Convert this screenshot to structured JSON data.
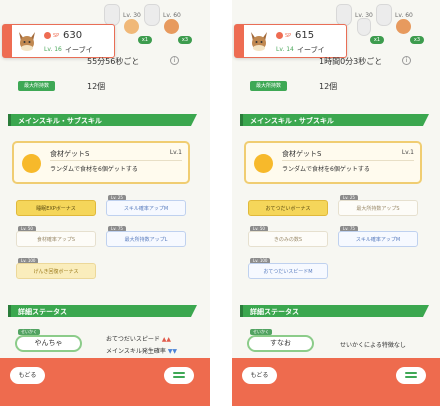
{
  "colors": {
    "accent_green": "#3ba74f",
    "accent_red": "#ee6c52",
    "skill_gold": "#f5d65a",
    "skill_blue": "#5a7dbf"
  },
  "left": {
    "top_items": [
      {
        "level": "Lv. 30",
        "count": "x1"
      },
      {
        "level": "Lv. 60",
        "count": "x3"
      }
    ],
    "pokemon": {
      "sp_label": "SP",
      "sp": "630",
      "level": "Lv. 16",
      "name": "イーブイ"
    },
    "help_time": "55分56秒ごと",
    "max_carry_label": "最大所持数",
    "max_carry": "12個",
    "section_skills": "メインスキル・サブスキル",
    "main_skill": {
      "name": "食材ゲットS",
      "level": "Lv.1",
      "desc": "ランダムで食材を6個ゲットする"
    },
    "sub_skills": [
      {
        "name": "睡眠EXPボーナス",
        "lv": "",
        "style": "gold"
      },
      {
        "name": "スキル確率アップM",
        "lv": "Lv. 25",
        "style": "blue"
      },
      {
        "name": "食材確率アップS",
        "lv": "Lv. 50",
        "style": "white"
      },
      {
        "name": "最大所持数アップL",
        "lv": "Lv. 75",
        "style": "blue"
      },
      {
        "name": "げんき回復ボーナス",
        "lv": "Lv. 100",
        "style": "pale"
      }
    ],
    "section_detail": "詳細ステータス",
    "nature_tag": "せいかく",
    "nature": "やんちゃ",
    "effect_up": "おてつだいスピード",
    "effect_down": "メインスキル発生確率",
    "back": "もどる"
  },
  "right": {
    "top_items": [
      {
        "level": "Lv. 30",
        "count": "x1"
      },
      {
        "level": "Lv. 60",
        "count": "x3"
      }
    ],
    "pokemon": {
      "sp_label": "SP",
      "sp": "615",
      "level": "Lv. 14",
      "name": "イーブイ"
    },
    "help_time": "1時間0分3秒ごと",
    "max_carry_label": "最大所持数",
    "max_carry": "12個",
    "section_skills": "メインスキル・サブスキル",
    "main_skill": {
      "name": "食材ゲットS",
      "level": "Lv.1",
      "desc": "ランダムで食材を6個ゲットする"
    },
    "sub_skills": [
      {
        "name": "おてつだいボーナス",
        "lv": "",
        "style": "gold"
      },
      {
        "name": "最大所持数アップS",
        "lv": "Lv. 25",
        "style": "white"
      },
      {
        "name": "きのみの数S",
        "lv": "Lv. 50",
        "style": "white"
      },
      {
        "name": "スキル確率アップM",
        "lv": "Lv. 75",
        "style": "blue"
      },
      {
        "name": "おてつだいスピードM",
        "lv": "Lv. 100",
        "style": "blue"
      }
    ],
    "section_detail": "詳細ステータス",
    "nature_tag": "せいかく",
    "nature": "すなお",
    "effect_none": "せいかくによる特徴なし",
    "back": "もどる"
  }
}
